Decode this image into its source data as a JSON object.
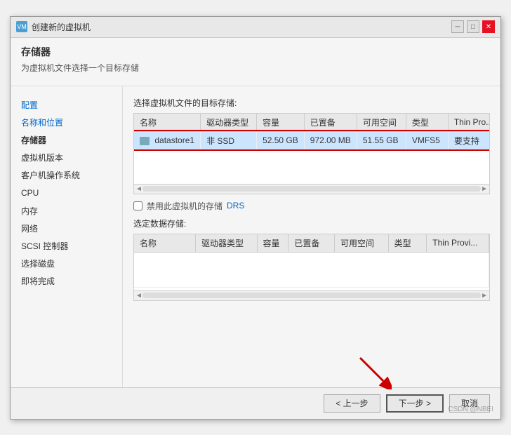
{
  "window": {
    "title": "创建新的虚拟机",
    "title_icon": "vm",
    "min_btn": "─",
    "max_btn": "□",
    "close_btn": "✕"
  },
  "header": {
    "title": "存储器",
    "description": "为虚拟机文件选择一个目标存储"
  },
  "sidebar": {
    "items": [
      {
        "id": "config",
        "label": "配置",
        "type": "link"
      },
      {
        "id": "name",
        "label": "名称和位置",
        "type": "link"
      },
      {
        "id": "storage",
        "label": "存储器",
        "type": "bold"
      },
      {
        "id": "version",
        "label": "虚拟机版本",
        "type": "normal"
      },
      {
        "id": "os",
        "label": "客户机操作系统",
        "type": "normal"
      },
      {
        "id": "cpu",
        "label": "CPU",
        "type": "normal"
      },
      {
        "id": "memory",
        "label": "内存",
        "type": "normal"
      },
      {
        "id": "network",
        "label": "网络",
        "type": "normal"
      },
      {
        "id": "scsi",
        "label": "SCSI 控制器",
        "type": "normal"
      },
      {
        "id": "disk",
        "label": "选择磁盘",
        "type": "normal"
      },
      {
        "id": "finish",
        "label": "即将完成",
        "type": "normal"
      }
    ]
  },
  "main": {
    "table_label": "选择虚拟机文件的目标存储:",
    "columns": {
      "name": "名称",
      "driver_type": "驱动器类型",
      "capacity": "容量",
      "provisioned": "已置备",
      "free_space": "可用空间",
      "type": "类型",
      "thin_prov": "Thin Pro..."
    },
    "rows": [
      {
        "name": "datastore1",
        "driver_type": "非 SSD",
        "capacity": "52.50 GB",
        "provisioned": "972.00 MB",
        "free_space": "51.55 GB",
        "type": "VMFS5",
        "thin_prov": "要支持",
        "selected": true
      }
    ],
    "checkbox_label": "禁用此虚拟机的存储 DRS",
    "checkbox_checked": false,
    "select_storage_label": "选定数据存储:",
    "select_columns": {
      "name": "名称",
      "driver_type": "驱动器类型",
      "capacity": "容量",
      "provisioned": "已置备",
      "free_space": "可用空间",
      "type": "类型",
      "thin_prov": "Thin Provi..."
    }
  },
  "footer": {
    "back_btn": "< 上一步",
    "next_btn": "下一步 >",
    "cancel_btn": "取消"
  },
  "watermark": "CSDN @NBEI"
}
